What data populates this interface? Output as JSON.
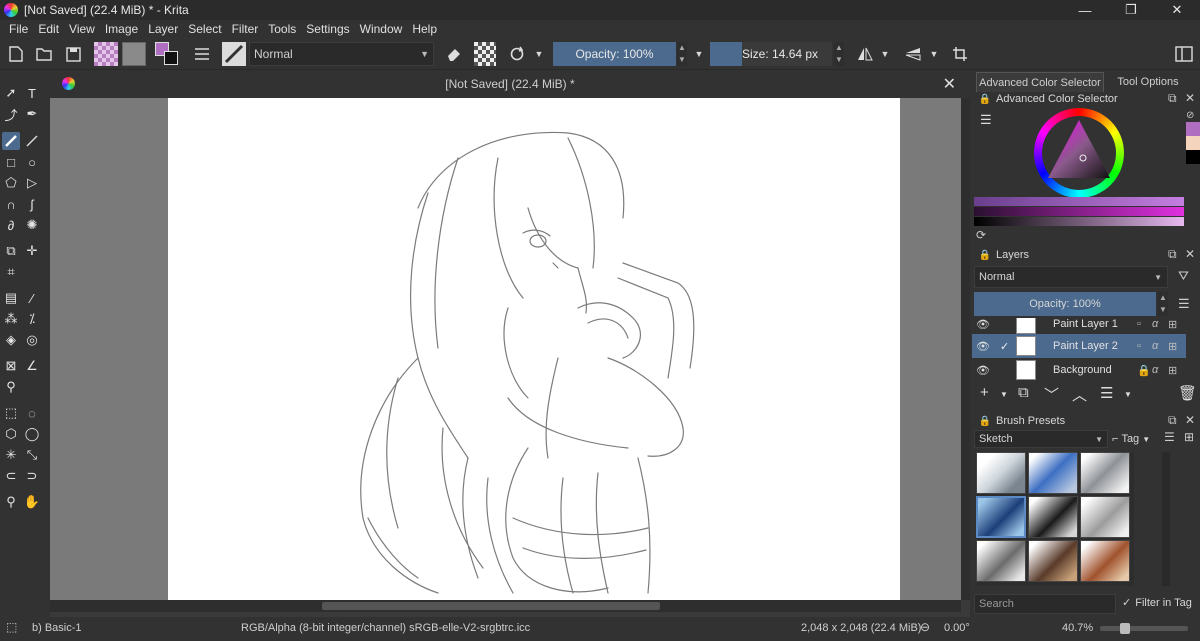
{
  "window": {
    "title": "[Not Saved]  (22.4 MiB) * - Krita",
    "minimize": "—",
    "maximize": "❐",
    "close": "✕"
  },
  "menu": [
    "File",
    "Edit",
    "View",
    "Image",
    "Layer",
    "Select",
    "Filter",
    "Tools",
    "Settings",
    "Window",
    "Help"
  ],
  "toolbar": {
    "blend_mode": "Normal",
    "opacity": "Opacity: 100%",
    "size": "Size: 14.64 px"
  },
  "document": {
    "tab_title": "[Not Saved]  (22.4 MiB) *",
    "close": "✕"
  },
  "dock": {
    "tabs": [
      "Advanced Color Selector",
      "Tool Options"
    ],
    "color_selector_title": "Advanced Color Selector",
    "layers_title": "Layers",
    "layers_blend": "Normal",
    "layers_opacity": "Opacity:  100%",
    "layers": [
      {
        "name": "Paint Layer 1",
        "visible": true,
        "selected": false
      },
      {
        "name": "Paint Layer 2",
        "visible": true,
        "selected": true
      },
      {
        "name": "Background",
        "visible": true,
        "selected": false,
        "locked": true
      }
    ],
    "brush_presets_title": "Brush Presets",
    "brush_tag": "Sketch",
    "tag_button": "Tag",
    "search_placeholder": "Search",
    "filter_in_tag": "Filter in Tag",
    "filter_checked": true
  },
  "status": {
    "brush": "b) Basic-1",
    "color_space": "RGB/Alpha (8-bit integer/channel)  sRGB-elle-V2-srgbtrc.icc",
    "dimensions": "2,048 x 2,048 (22.4 MiB)",
    "rotation": "0.00°",
    "zoom": "40.7%"
  },
  "colors": {
    "accent": "#4b6a8e",
    "fg_color": "#b06ec0",
    "bg_color": "#8a8a8a"
  }
}
